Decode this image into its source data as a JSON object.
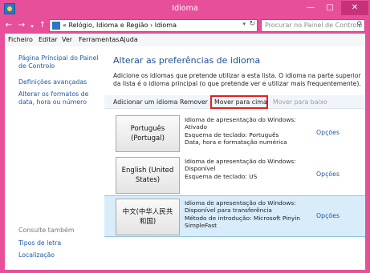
{
  "window": {
    "title": "Idioma"
  },
  "address": {
    "breadcrumb": "« Relógio, Idioma e Região  ›  Idioma",
    "search_placeholder": "Procurar no Painel de Controlo"
  },
  "menu": [
    "Ficheiro",
    "Editar",
    "Ver",
    "Ferramentas",
    "Ajuda"
  ],
  "sidebar": {
    "links": [
      "Página Principal do Painel de Controlo",
      "Definições avançadas",
      "Alterar os formatos de data, hora ou número"
    ],
    "see_also_label": "Consulte também",
    "see_also_links": [
      "Tipos de letra",
      "Localização"
    ]
  },
  "main": {
    "heading": "Alterar as preferências de idioma",
    "description": "Adicione os idiomas que pretende utilizar a esta lista. O idioma na parte superior da lista é o idioma principal (o que pretende ver e utilizar mais frequentemente).",
    "toolbar": {
      "add": "Adicionar um idioma",
      "remove": "Remover",
      "move_up": "Mover para cima",
      "move_down": "Mover para baixo"
    },
    "languages": [
      {
        "name": "Português (Portugal)",
        "details": [
          "Idioma de apresentação do Windows:",
          "Ativado",
          "Esquema de teclado: Português",
          "Data, hora e formatação numérica"
        ],
        "options": "Opções"
      },
      {
        "name": "English (United States)",
        "details": [
          "Idioma de apresentação do Windows:",
          "Disponível",
          "Esquema de teclado: US"
        ],
        "options": "Opções"
      },
      {
        "name": "中文(中华人民共和国)",
        "details": [
          "Idioma de apresentação do Windows:",
          "Disponível para transferência",
          "Método de introdução: Microsoft Pinyin",
          "SimpleFast"
        ],
        "options": "Opções"
      }
    ]
  },
  "colors": {
    "title_bar": "#e84f9a",
    "link": "#1e5aa8",
    "heading": "#1e4f8f",
    "highlight_border": "#e02020",
    "selected_row": "#d8ecfa"
  }
}
